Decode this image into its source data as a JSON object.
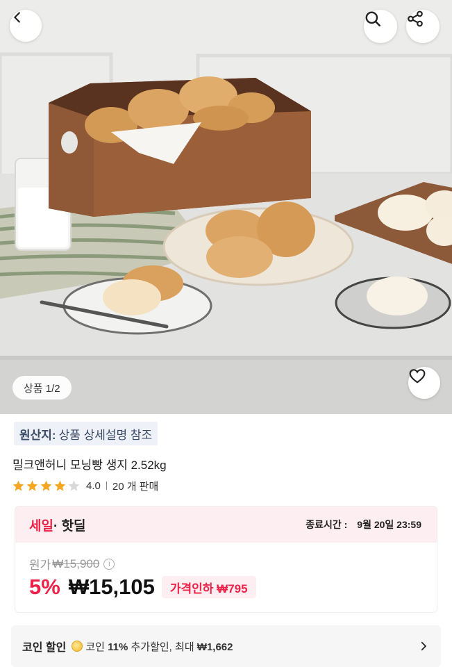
{
  "hero": {
    "image_counter": "상품 1/2",
    "image_alt": "bread-rolls-product-photo"
  },
  "icons": {
    "back": "chevron-left-icon",
    "search": "search-icon",
    "share": "share-icon",
    "like": "heart-icon",
    "star": "star-icon",
    "info": "info-icon",
    "coin": "coin-icon",
    "next": "chevron-right-icon"
  },
  "product": {
    "origin_label": "원산지:",
    "origin_value": "상품 상세설명 참조",
    "title": "밀크앤허니 모닝빵 생지 2.52kg",
    "rating": 4.0,
    "rating_text": "4.0",
    "sold_count": "20 개 판매"
  },
  "sale": {
    "tag_red": "세일",
    "tag_dark": "· 핫딜",
    "end_label": "종료시간 :",
    "end_time": "9월 20일 23:59",
    "original_label": "원가",
    "original_price": "₩15,900",
    "info_glyph": "i",
    "discount_rate": "5%",
    "final_price": "₩15,105",
    "price_cut": "가격인하 ₩795"
  },
  "coin": {
    "title": "코인 할인",
    "desc_prefix": "코인 ",
    "desc_rate": "11%",
    "desc_suffix": " 추가할인, 최대 ",
    "desc_max": "₩1,662"
  },
  "colors": {
    "accent_red": "#ec2248",
    "sale_bg": "#fdeef1",
    "origin_bg": "#eef2f8",
    "star": "#f5a623",
    "star_empty": "#d9d9d9"
  }
}
